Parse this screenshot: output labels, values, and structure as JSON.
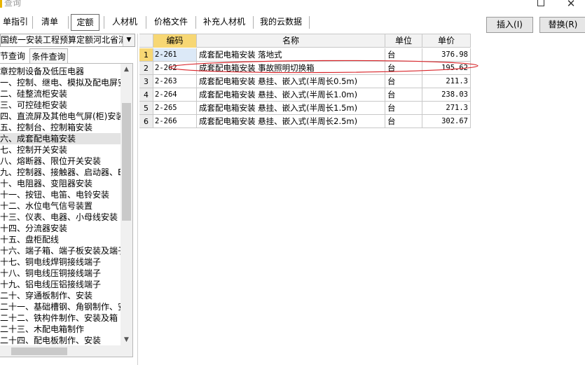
{
  "window": {
    "title": "查询",
    "maximize_glyph": "□",
    "close_glyph": "✕"
  },
  "tabs": [
    {
      "label": "单指引",
      "active": false
    },
    {
      "label": "清单",
      "active": false
    },
    {
      "label": "定额",
      "active": true
    },
    {
      "label": "人材机",
      "active": false
    },
    {
      "label": "价格文件",
      "active": false
    },
    {
      "label": "补充人材机",
      "active": false
    },
    {
      "label": "我的云数据",
      "active": false
    }
  ],
  "actions": {
    "insert_label": "插入(I)",
    "replace_label": "替换(R)"
  },
  "left_panel": {
    "quota_library": "国统一安装工程预算定额河北省消",
    "subtabs": [
      {
        "label": "节查询",
        "active": true
      },
      {
        "label": "条件查询",
        "active": false
      }
    ],
    "tree_items": [
      "章控制设备及低压电器",
      "一、控制、继电、模拟及配电屏安",
      "二、硅整流柜安装",
      "三、可控硅柜安装",
      "四、直流屏及其他电气屏(柜)安装",
      "五、控制台、控制箱安装",
      "六、成套配电箱安装",
      "七、控制开关安装",
      "八、熔断器、限位开关安装",
      "九、控制器、接触器、启动器、E",
      "十、电阻器、变阻器安装",
      "十一、按钮、电笛、电铃安装",
      "十二、水位电气信号装置",
      "十三、仪表、电器、小母线安装",
      "十四、分流器安装",
      "十五、盘柜配线",
      "十六、端子箱、端子板安装及端子",
      "十七、铜电线焊铜接线端子",
      "十八、铜电线压铜接线端子",
      "十九、铝电线压铝接线端子",
      "二十、穿通板制作、安装",
      "二十一、基础槽钢、角钢制作、安",
      "二十二、铁构件制作、安装及箱",
      "二十三、木配电箱制作",
      "二十四、配电板制作、安装"
    ],
    "selected_index": 6
  },
  "grid": {
    "headers": {
      "code": "编码",
      "name": "名称",
      "unit": "单位",
      "price": "单价"
    },
    "rows": [
      {
        "num": "1",
        "code": "2-261",
        "name": "成套配电箱安装 落地式",
        "unit": "台",
        "price": "376.98"
      },
      {
        "num": "2",
        "code": "2-262",
        "name": "成套配电箱安装 事故照明切换箱",
        "unit": "台",
        "price": "195.62"
      },
      {
        "num": "3",
        "code": "2-263",
        "name": "成套配电箱安装 悬挂、嵌入式(半周长0.5m)",
        "unit": "台",
        "price": "211.3"
      },
      {
        "num": "4",
        "code": "2-264",
        "name": "成套配电箱安装 悬挂、嵌入式(半周长1.0m)",
        "unit": "台",
        "price": "238.03"
      },
      {
        "num": "5",
        "code": "2-265",
        "name": "成套配电箱安装 悬挂、嵌入式(半周长1.5m)",
        "unit": "台",
        "price": "271.3"
      },
      {
        "num": "6",
        "code": "2-266",
        "name": "成套配电箱安装 悬挂、嵌入式(半周长2.5m)",
        "unit": "台",
        "price": "302.67"
      }
    ],
    "current_row": 0
  },
  "colors": {
    "accent_header": "#f7d774",
    "annotation_ellipse": "#d9262b",
    "selected_cell": "#dce9f7"
  }
}
